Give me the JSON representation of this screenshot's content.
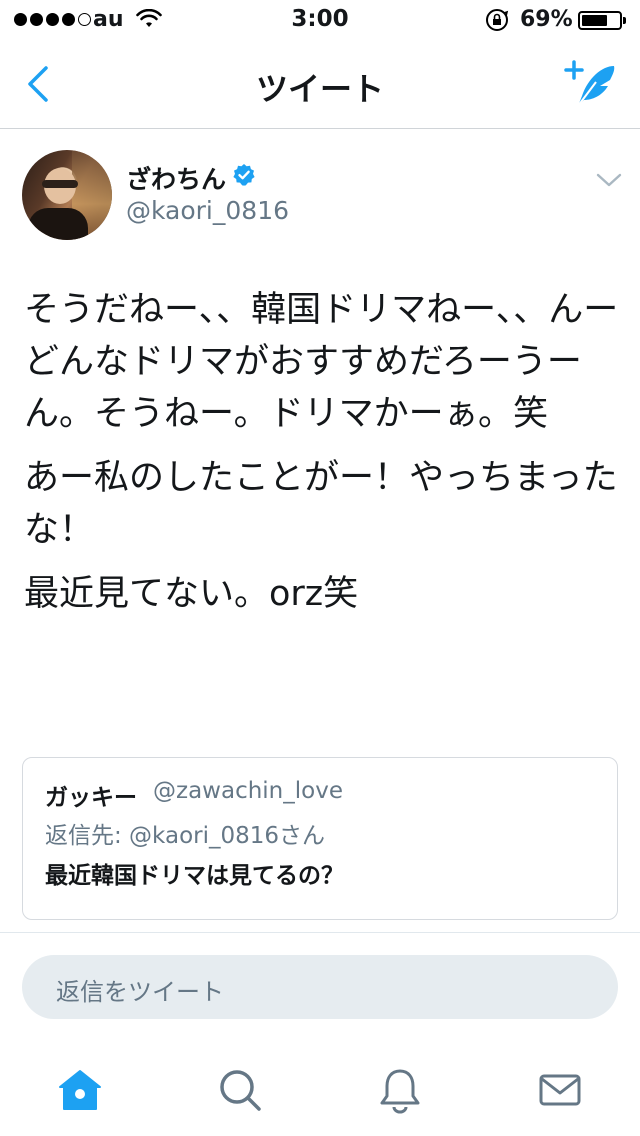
{
  "status_bar": {
    "carrier": "au",
    "time": "3:00",
    "battery_percent_label": "69%",
    "battery_level": 0.69
  },
  "nav": {
    "title": "ツイート",
    "back_icon": "chevron-left-icon",
    "compose_icon": "compose-tweet-icon"
  },
  "tweet": {
    "display_name": "ざわちん",
    "handle": "@kaori_0816",
    "verified": true,
    "paragraphs": [
      "そうだねー、、韓国ドリマねー、、んーどんなドリマがおすすめだろーうーん。そうねー。ドリマかーぁ。笑",
      "あー私のしたことがー！やっちまったな！",
      "最近見てない。orz笑"
    ]
  },
  "quoted_tweet": {
    "name": "ガッキー",
    "handle": "@zawachin_love",
    "reply_to": "返信先: @kaori_0816さん",
    "text": "最近韓国ドリマは見てるの？"
  },
  "reply": {
    "placeholder": "返信をツイート"
  },
  "tab_bar": {
    "tabs": [
      "home-icon",
      "search-icon",
      "notifications-icon",
      "messages-icon"
    ],
    "active": "home-icon"
  },
  "colors": {
    "accent": "#1da1f2",
    "secondary_text": "#657786",
    "text": "#14171a",
    "tab_inactive": "#657786"
  }
}
